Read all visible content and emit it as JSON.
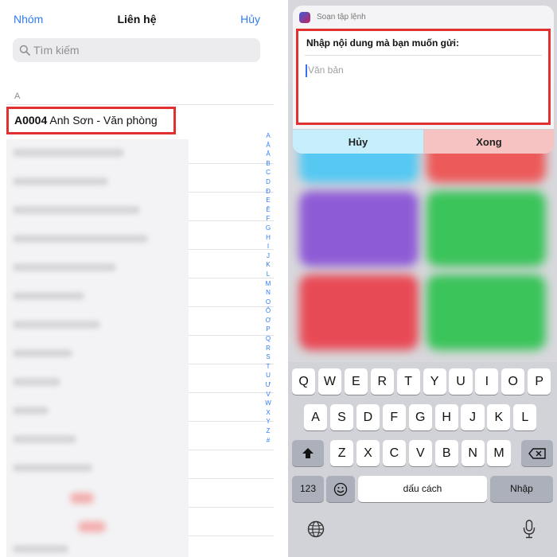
{
  "left": {
    "nav": {
      "groups": "Nhóm",
      "title": "Liên hệ",
      "cancel": "Hủy"
    },
    "search": {
      "placeholder": "Tìm kiếm",
      "icon": "search-icon"
    },
    "section_header": "A",
    "contact": {
      "code": "A0004",
      "name": "Anh Sơn - Văn phòng"
    },
    "index_letters": [
      "A",
      "Ă",
      "Â",
      "B",
      "C",
      "D",
      "Đ",
      "E",
      "Ê",
      "F",
      "G",
      "H",
      "I",
      "J",
      "K",
      "L",
      "M",
      "N",
      "O",
      "Ô",
      "Ơ",
      "P",
      "Q",
      "R",
      "S",
      "T",
      "U",
      "Ư",
      "V",
      "W",
      "X",
      "Y",
      "Z",
      "#"
    ]
  },
  "right": {
    "app_name": "Soạn tập lệnh",
    "prompt": "Nhập nội dung mà bạn muốn gửi:",
    "input_placeholder": "Văn bản",
    "cancel": "Hủy",
    "done": "Xong",
    "keyboard": {
      "row1": [
        "Q",
        "W",
        "E",
        "R",
        "T",
        "Y",
        "U",
        "I",
        "O",
        "P"
      ],
      "row2": [
        "A",
        "S",
        "D",
        "F",
        "G",
        "H",
        "J",
        "K",
        "L"
      ],
      "row3": [
        "Z",
        "X",
        "C",
        "V",
        "B",
        "N",
        "M"
      ],
      "numbers": "123",
      "space": "dấu cách",
      "return": "Nhập",
      "icons": [
        "shift-icon",
        "delete-icon",
        "emoji-icon",
        "globe-icon",
        "microphone-icon"
      ]
    }
  },
  "colors": {
    "accent": "#2f7cf6",
    "highlight_border": "#e03030"
  }
}
